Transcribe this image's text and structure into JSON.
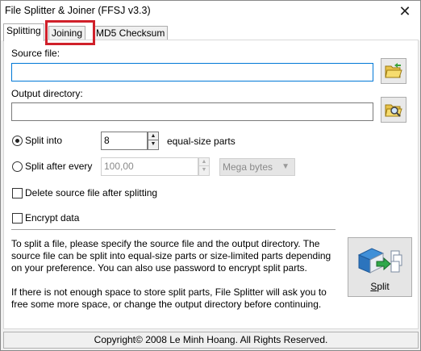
{
  "window": {
    "title": "File Splitter & Joiner (FFSJ v3.3)"
  },
  "tabs": [
    {
      "label": "Splitting",
      "active": true
    },
    {
      "label": "Joining",
      "active": false,
      "highlighted": true
    },
    {
      "label": "MD5 Checksum",
      "active": false
    }
  ],
  "splitting": {
    "source_label": "Source file:",
    "source_value": "",
    "output_label": "Output directory:",
    "output_value": "",
    "split_into": {
      "label": "Split into",
      "value": "8",
      "suffix": "equal-size parts",
      "selected": true
    },
    "split_after": {
      "label": "Split after every",
      "value": "100,00",
      "unit": "Mega bytes",
      "selected": false
    },
    "delete_source": {
      "label": "Delete source file after splitting",
      "checked": false
    },
    "encrypt": {
      "label": "Encrypt data",
      "checked": false
    },
    "help_1": "To split a file, please specify the source file and the output directory. The source file can be split into equal-size parts or size-limited parts depending on your preference. You can also use password to encrypt split parts.",
    "help_2": "If there is not enough space to store split parts, File Splitter will ask you to free some more space, or change the output directory before continuing.",
    "split_button": {
      "prefix": "S",
      "rest": "plit"
    }
  },
  "footer": {
    "copyright": "Copyright© 2008 Le Minh Hoang. All Rights Reserved."
  },
  "icons": {
    "close": "close-icon",
    "open_file": "folder-open-icon",
    "browse_folder": "folder-search-icon",
    "split": "split-book-icon"
  },
  "colors": {
    "accent": "#0078d7",
    "highlight": "#d0202a"
  }
}
